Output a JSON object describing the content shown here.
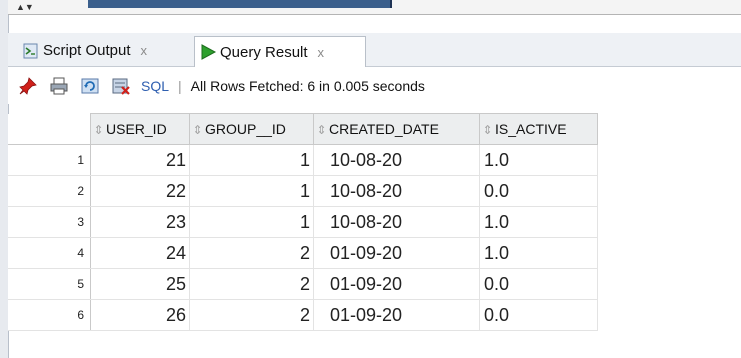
{
  "tabs": [
    {
      "label": "Script Output",
      "close": "x",
      "active": false
    },
    {
      "label": "Query Result",
      "close": "x",
      "active": true
    }
  ],
  "toolbar": {
    "icons": [
      "pin-icon",
      "print-icon",
      "refresh-icon",
      "sql-export-icon"
    ],
    "sql_label": "SQL",
    "separator": "|",
    "status": "All Rows Fetched: 6 in 0.005 seconds"
  },
  "grid": {
    "columns": [
      "USER_ID",
      "GROUP__ID",
      "CREATED_DATE",
      "IS_ACTIVE"
    ],
    "rows": [
      {
        "num": "1",
        "user_id": "21",
        "group_id": "1",
        "created_date": "10-08-20",
        "is_active": "1.0"
      },
      {
        "num": "2",
        "user_id": "22",
        "group_id": "1",
        "created_date": "10-08-20",
        "is_active": "0.0"
      },
      {
        "num": "3",
        "user_id": "23",
        "group_id": "1",
        "created_date": "10-08-20",
        "is_active": "1.0"
      },
      {
        "num": "4",
        "user_id": "24",
        "group_id": "2",
        "created_date": "01-09-20",
        "is_active": "1.0"
      },
      {
        "num": "5",
        "user_id": "25",
        "group_id": "2",
        "created_date": "01-09-20",
        "is_active": "0.0"
      },
      {
        "num": "6",
        "user_id": "26",
        "group_id": "2",
        "created_date": "01-09-20",
        "is_active": "0.0"
      }
    ]
  },
  "colors": {
    "accent_link": "#2f5fb0",
    "run_green": "#2ea02e",
    "pin_red": "#d0201a"
  }
}
